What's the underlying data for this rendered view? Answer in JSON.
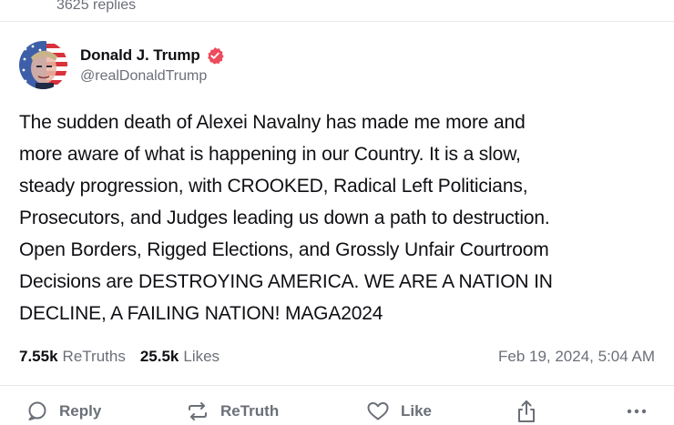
{
  "thread": {
    "replies_count": "3625 replies"
  },
  "post": {
    "author": {
      "display_name": "Donald J. Trump",
      "handle": "@realDonaldTrump",
      "verified_icon": "verified-badge-icon"
    },
    "text": "The sudden death of Alexei Navalny has made me more and\nmore aware of what is happening in our Country. It is a slow,\nsteady progression, with CROOKED, Radical Left Politicians,\nProsecutors, and Judges leading us down a path to destruction.\nOpen Borders, Rigged Elections, and Grossly Unfair Courtroom\nDecisions are DESTROYING AMERICA. WE ARE A NATION IN\nDECLINE, A FAILING NATION! MAGA2024",
    "stats": {
      "retruths_count": "7.55k",
      "retruths_label": "ReTruths",
      "likes_count": "25.5k",
      "likes_label": "Likes"
    },
    "timestamp": "Feb 19, 2024, 5:04 AM"
  },
  "actions": {
    "reply_label": "Reply",
    "retruth_label": "ReTruth",
    "like_label": "Like"
  },
  "colors": {
    "text": "#0f0f14",
    "muted": "#6b6f78",
    "verified": "#ee4b5c",
    "divider": "#e6e7ea"
  }
}
